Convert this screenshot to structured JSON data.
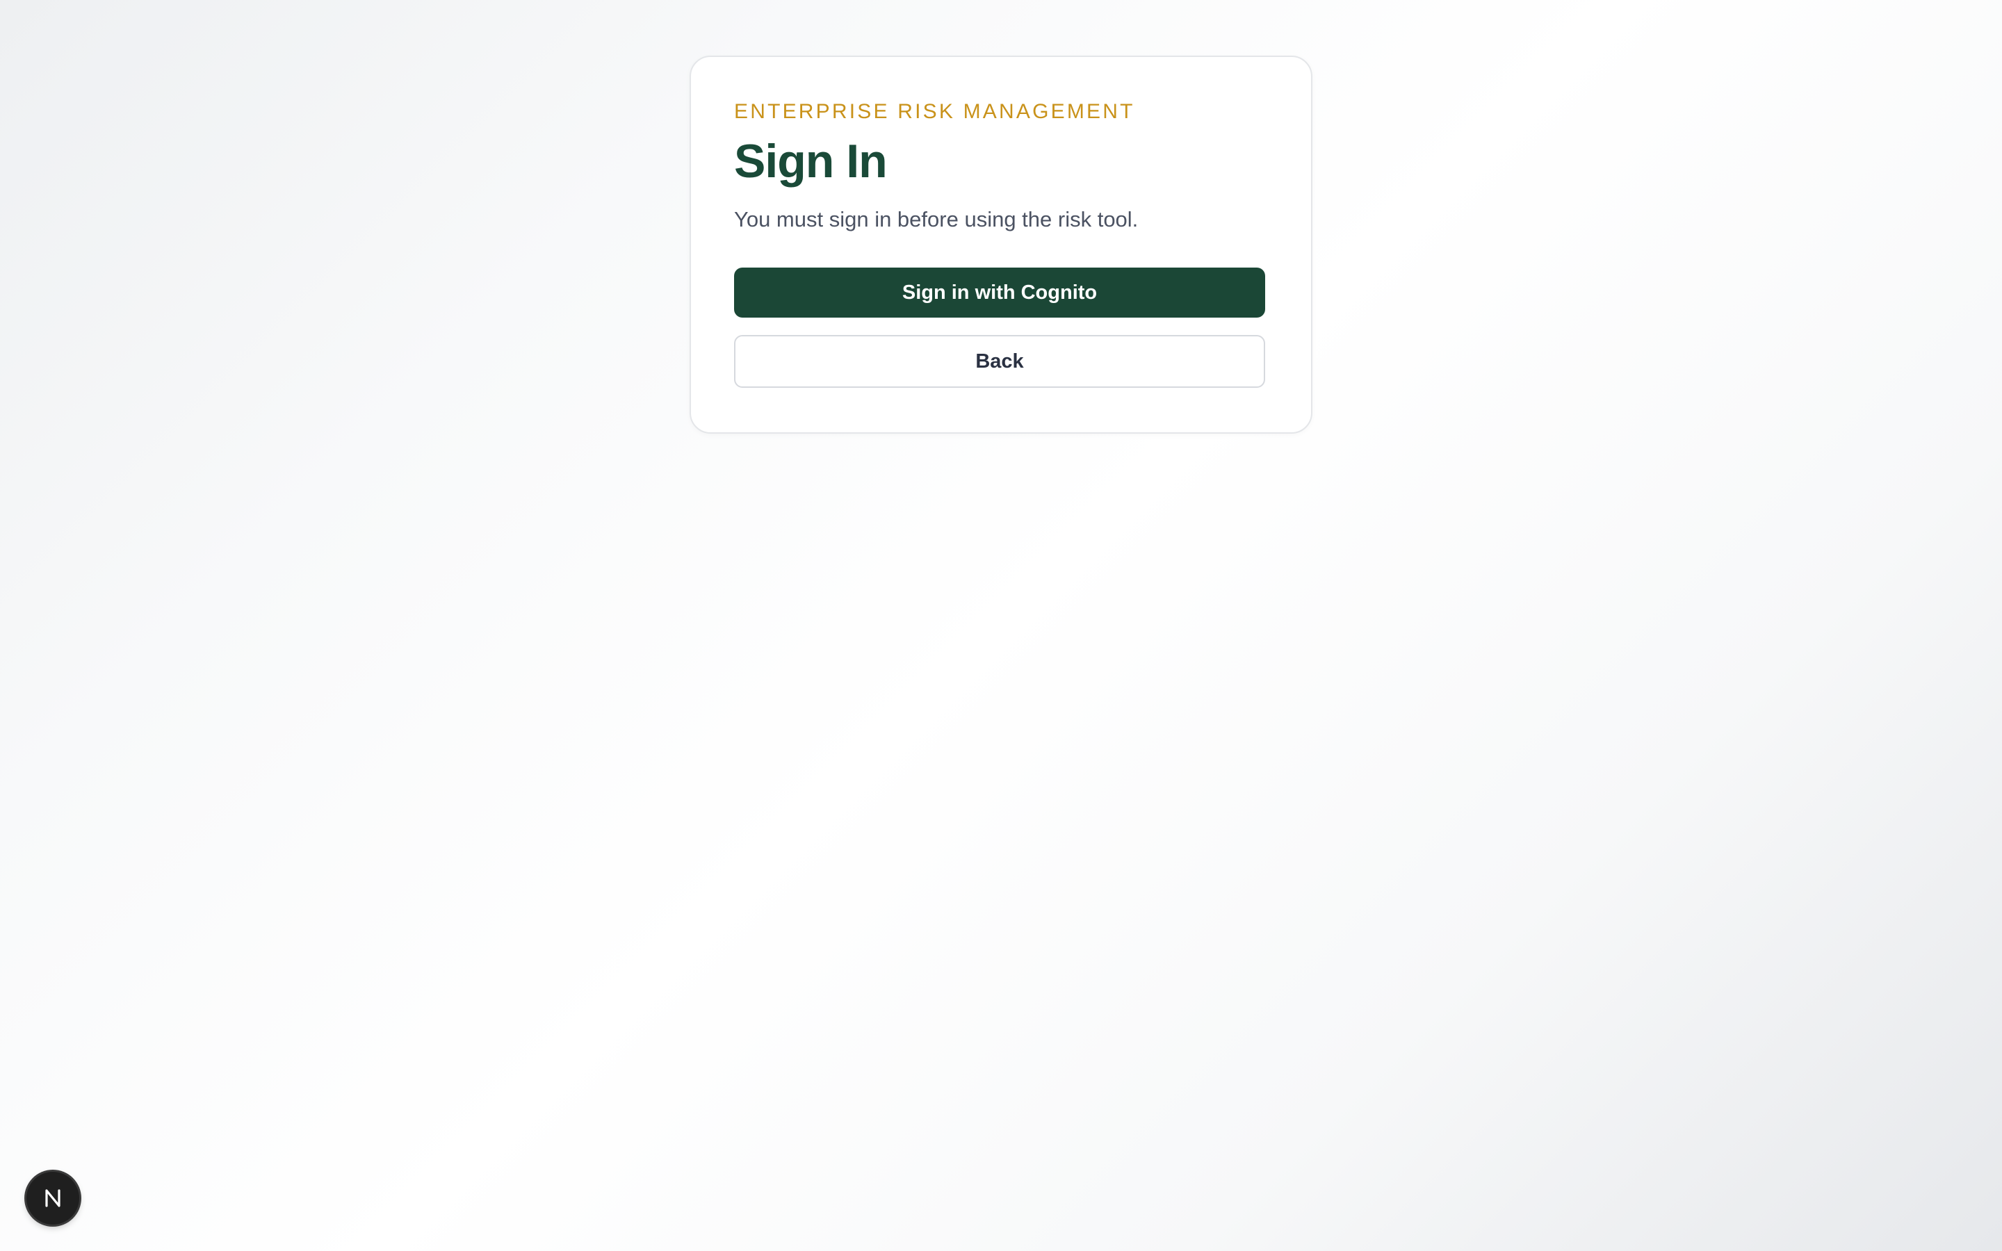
{
  "login_card": {
    "eyebrow": "ENTERPRISE RISK MANAGEMENT",
    "title": "Sign In",
    "subtitle": "You must sign in before using the risk tool.",
    "primary_button_label": "Sign in with Cognito",
    "secondary_button_label": "Back"
  },
  "dev_badge": {
    "icon": "nextjs-logo-icon",
    "letter": "N"
  },
  "colors": {
    "eyebrow": "#c9921a",
    "title": "#1a4a38",
    "primary_button": "#1b4736",
    "badge": "#1f1f1f"
  }
}
